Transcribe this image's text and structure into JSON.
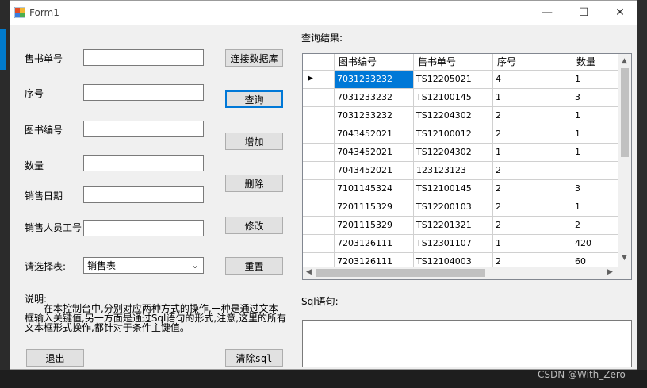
{
  "window": {
    "title": "Form1",
    "minimize_glyph": "—",
    "maximize_glyph": "☐",
    "close_glyph": "✕"
  },
  "form": {
    "sale_no_label": "售书单号",
    "seq_label": "序号",
    "book_no_label": "图书编号",
    "qty_label": "数量",
    "sale_date_label": "销售日期",
    "staff_no_label": "销售人员工号",
    "choose_table_label": "请选择表:",
    "table_selected": "销售表",
    "sale_no_value": "",
    "seq_value": "",
    "book_no_value": "",
    "qty_value": "",
    "sale_date_value": "",
    "staff_no_value": ""
  },
  "buttons": {
    "connect": "连接数据库",
    "query": "查询",
    "add": "增加",
    "delete": "删除",
    "modify": "修改",
    "reset": "重置",
    "exit": "退出",
    "clear_sql": "清除sql"
  },
  "description": {
    "heading": "说明:",
    "body": "在本控制台中,分别对应两种方式的操作,一种是通过文本框输入关键值,另一方面是通过Sql语句的形式,注意,这里的所有文本框形式操作,都针对于条件主键值。"
  },
  "results": {
    "label": "查询结果:",
    "columns": [
      "图书编号",
      "售书单号",
      "序号",
      "数量"
    ],
    "rows": [
      [
        "7031233232",
        "TS12205021",
        "4",
        "1"
      ],
      [
        "7031233232",
        "TS12100145",
        "1",
        "3"
      ],
      [
        "7031233232",
        "TS12204302",
        "2",
        "1"
      ],
      [
        "7043452021",
        "TS12100012",
        "2",
        "1"
      ],
      [
        "7043452021",
        "TS12204302",
        "1",
        "1"
      ],
      [
        "7043452021",
        "123123123",
        "2",
        ""
      ],
      [
        "7101145324",
        "TS12100145",
        "2",
        "3"
      ],
      [
        "7201115329",
        "TS12200103",
        "2",
        "1"
      ],
      [
        "7201115329",
        "TS12201321",
        "2",
        "2"
      ],
      [
        "7203126111",
        "TS12301107",
        "1",
        "420"
      ],
      [
        "7203126111",
        "TS12104003",
        "2",
        "60"
      ]
    ]
  },
  "sql": {
    "label": "Sql语句:",
    "value": ""
  },
  "watermark": "CSDN @With_Zero",
  "colors": {
    "selection": "#0078d7",
    "focus_border": "#0078d7",
    "window_bg": "#f0f0f0"
  },
  "icons": {
    "app": "form-app-icon",
    "row_pointer": "triangle-right-icon"
  }
}
